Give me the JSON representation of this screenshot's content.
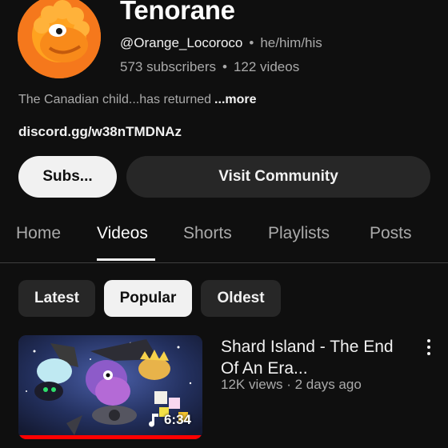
{
  "channel": {
    "name": "Tenorane",
    "handle": "@Orange_Locoroco",
    "pronouns": "he/him/his",
    "subscribers": "573 subscribers",
    "videos_count": "122 videos",
    "description": "The Canadian child...has returned",
    "more_label": "...more",
    "link": "discord.gg/w38nTMDNAz",
    "separator": "•"
  },
  "buttons": {
    "subscribe_label": "Subs...",
    "community_label": "Visit Community"
  },
  "tabs": [
    {
      "label": "Home"
    },
    {
      "label": "Videos"
    },
    {
      "label": "Shorts"
    },
    {
      "label": "Playlists"
    },
    {
      "label": "Posts"
    }
  ],
  "active_tab": "Videos",
  "filters": [
    {
      "label": "Latest"
    },
    {
      "label": "Popular"
    },
    {
      "label": "Oldest"
    }
  ],
  "selected_filter": "Popular",
  "video": {
    "title": "Shard Island - The End Of An Era...",
    "views": "12K views",
    "age": "2 days ago",
    "meta_separator": "·",
    "duration": "6:34",
    "watched_fraction": 1.0,
    "duration_icon": "music-note-icon"
  },
  "colors": {
    "background": "#0f0f0f",
    "accent_progress": "#ff0000",
    "avatar": "#f5781c"
  }
}
